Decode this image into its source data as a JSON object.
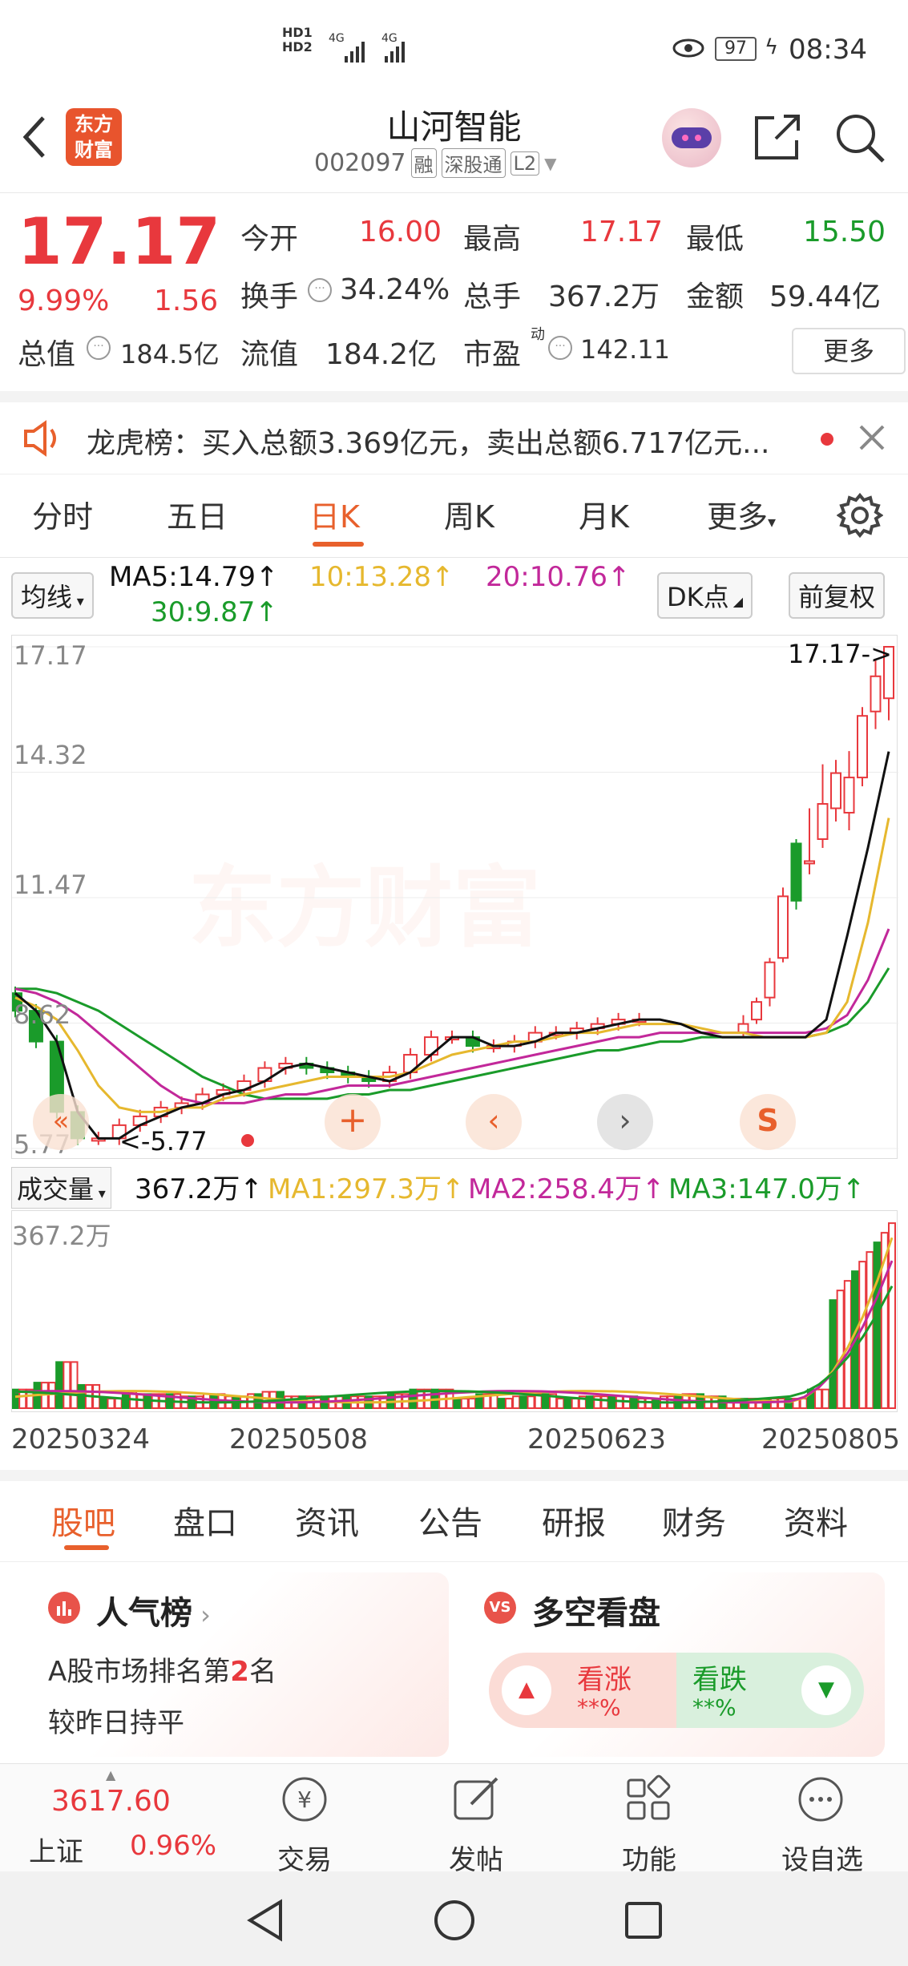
{
  "status_bar": {
    "time": "08:34",
    "battery": "97",
    "signal_text_1": "HD1",
    "signal_text_2": "HD2",
    "net1": "4G",
    "net2": "4G"
  },
  "header": {
    "logo_line1": "东方",
    "logo_line2": "财富",
    "stock_name": "山河智能",
    "stock_code": "002097",
    "tag_rong": "融",
    "tag_sgt": "深股通",
    "tag_l2": "L2"
  },
  "quote": {
    "price": "17.17",
    "change_pct": "9.99%",
    "change_amt": "1.56",
    "open_label": "今开",
    "open": "16.00",
    "high_label": "最高",
    "high": "17.17",
    "low_label": "最低",
    "low": "15.50",
    "turnover_label": "换手",
    "turnover": "34.24%",
    "volume_label": "总手",
    "volume": "367.2万",
    "amount_label": "金额",
    "amount": "59.44亿",
    "mktcap_label": "总值",
    "mktcap": "184.5亿",
    "float_label": "流值",
    "float": "184.2亿",
    "pe_label": "市盈",
    "pe_super": "动",
    "pe": "142.11",
    "more_button": "更多"
  },
  "lhb": {
    "text": "龙虎榜：买入总额3.369亿元，卖出总额6.717亿元..."
  },
  "kline_tabs": [
    "分时",
    "五日",
    "日K",
    "周K",
    "月K",
    "更多"
  ],
  "ma": {
    "selector": "均线",
    "ma5": "MA5:14.79",
    "ma10": "10:13.28",
    "ma20": "20:10.76",
    "ma30": "30:9.87",
    "dk": "DK点",
    "fq": "前复权"
  },
  "price_axis": [
    "17.17",
    "14.32",
    "11.47",
    "8.62",
    "5.77"
  ],
  "price_max_label": "17.17->",
  "price_min_label": "<-5.77",
  "watermark": "东方财富",
  "volume_bar": {
    "selector": "成交量",
    "vol": "367.2万",
    "ma1": "MA1:297.3万",
    "ma2": "MA2:258.4万",
    "ma3": "MA3:147.0万",
    "axis_max": "367.2万"
  },
  "dates": [
    "20250324",
    "20250508",
    "20250623",
    "20250805"
  ],
  "feature_tabs": [
    "股吧",
    "盘口",
    "资讯",
    "公告",
    "研报",
    "财务",
    "资料"
  ],
  "card_left": {
    "title": "人气榜",
    "line1_prefix": "A股市场排名第",
    "rank": "2",
    "line1_suffix": "名",
    "line2": "较昨日持平"
  },
  "card_right": {
    "title": "多空看盘",
    "up_label": "看涨",
    "up_val": "**%",
    "down_label": "看跌",
    "down_val": "**%"
  },
  "bottom_nav": {
    "index_value": "3617.60",
    "index_name": "上证",
    "index_pct": "0.96%",
    "trade": "交易",
    "post": "发帖",
    "func": "功能",
    "custom": "设自选"
  },
  "colors": {
    "up": "#e8383d",
    "down": "#1a9b2a",
    "accent": "#e8602c",
    "ma5": "#111111",
    "ma10": "#e6b82e",
    "ma20": "#c2289a",
    "ma30": "#1a9b2a"
  },
  "chart_data": {
    "type": "candlestick",
    "ylim": [
      5.77,
      17.17
    ],
    "ma_close_samples": {
      "ma5": [
        9.3,
        8.9,
        8.2,
        6.6,
        6.0,
        6.0,
        6.3,
        6.5,
        6.7,
        6.8,
        7.0,
        7.1,
        7.3,
        7.6,
        7.7,
        7.6,
        7.5,
        7.4,
        7.3,
        7.5,
        7.9,
        8.3,
        8.3,
        8.1,
        8.1,
        8.2,
        8.4,
        8.4,
        8.5,
        8.6,
        8.7,
        8.7,
        8.6,
        8.4,
        8.3,
        8.3,
        8.3,
        8.3,
        8.3,
        8.7,
        10.6,
        12.6,
        14.79
      ],
      "ma10": [
        9.2,
        9.0,
        8.7,
        8.0,
        7.2,
        6.7,
        6.6,
        6.6,
        6.7,
        6.7,
        6.9,
        7.0,
        7.1,
        7.2,
        7.3,
        7.4,
        7.4,
        7.4,
        7.4,
        7.5,
        7.7,
        7.9,
        8.0,
        8.1,
        8.2,
        8.2,
        8.3,
        8.4,
        8.4,
        8.5,
        8.6,
        8.6,
        8.6,
        8.5,
        8.4,
        8.4,
        8.3,
        8.3,
        8.3,
        8.4,
        9.1,
        10.9,
        13.28
      ],
      "ma20": [
        9.4,
        9.3,
        9.1,
        8.8,
        8.4,
        8.0,
        7.6,
        7.2,
        6.9,
        6.8,
        6.8,
        6.8,
        6.9,
        7.0,
        7.0,
        7.1,
        7.2,
        7.2,
        7.2,
        7.3,
        7.4,
        7.5,
        7.6,
        7.7,
        7.8,
        7.9,
        8.0,
        8.1,
        8.2,
        8.3,
        8.3,
        8.4,
        8.4,
        8.4,
        8.4,
        8.4,
        8.4,
        8.4,
        8.4,
        8.5,
        8.8,
        9.6,
        10.76
      ],
      "ma30": [
        9.4,
        9.4,
        9.3,
        9.1,
        8.9,
        8.6,
        8.3,
        8.0,
        7.7,
        7.4,
        7.2,
        7.0,
        6.9,
        6.9,
        6.9,
        6.9,
        7.0,
        7.0,
        7.1,
        7.1,
        7.2,
        7.3,
        7.4,
        7.5,
        7.6,
        7.7,
        7.8,
        7.9,
        8.0,
        8.0,
        8.1,
        8.2,
        8.2,
        8.3,
        8.3,
        8.3,
        8.3,
        8.3,
        8.3,
        8.4,
        8.6,
        9.1,
        9.87
      ]
    },
    "last_candles": [
      {
        "o": 8.4,
        "c": 8.6,
        "h": 8.8,
        "l": 8.3
      },
      {
        "o": 8.7,
        "c": 9.1,
        "h": 9.2,
        "l": 8.6
      },
      {
        "o": 9.2,
        "c": 10.0,
        "h": 10.1,
        "l": 9.0
      },
      {
        "o": 10.1,
        "c": 11.5,
        "h": 11.7,
        "l": 10.0
      },
      {
        "o": 12.7,
        "c": 11.4,
        "h": 12.8,
        "l": 11.2
      },
      {
        "o": 12.3,
        "c": 12.3,
        "h": 13.5,
        "l": 12.0
      },
      {
        "o": 12.8,
        "c": 13.6,
        "h": 14.5,
        "l": 12.6
      },
      {
        "o": 13.5,
        "c": 14.3,
        "h": 14.6,
        "l": 13.2
      },
      {
        "o": 13.4,
        "c": 14.2,
        "h": 14.8,
        "l": 13.0
      },
      {
        "o": 14.2,
        "c": 15.6,
        "h": 15.8,
        "l": 14.0
      },
      {
        "o": 15.7,
        "c": 16.5,
        "h": 16.9,
        "l": 15.3
      },
      {
        "o": 16.0,
        "c": 17.17,
        "h": 17.17,
        "l": 15.5
      }
    ]
  }
}
